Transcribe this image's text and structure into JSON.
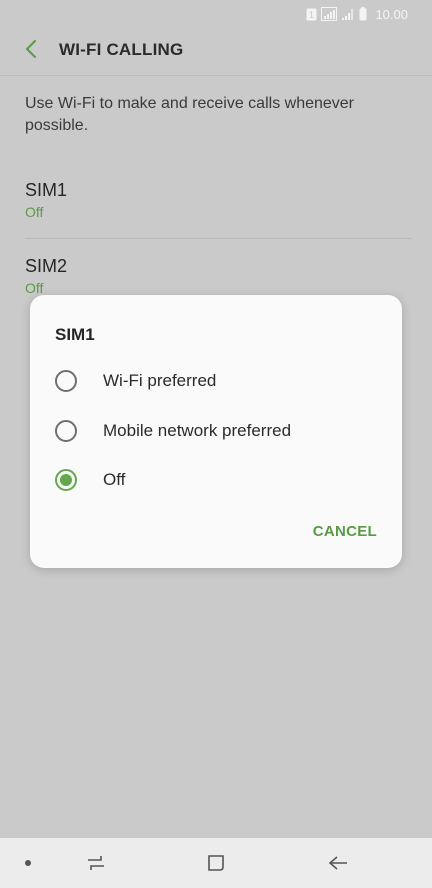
{
  "status_bar": {
    "sim_badge": "1",
    "time": "10.00",
    "icons": [
      "sim-1-icon",
      "signal-icon",
      "signal-weak-icon",
      "battery-icon"
    ]
  },
  "header": {
    "title": "WI-FI CALLING",
    "back_icon": "chevron-left-icon"
  },
  "description": "Use Wi-Fi to make and receive calls whenever possible.",
  "settings": [
    {
      "title": "SIM1",
      "value": "Off"
    },
    {
      "title": "SIM2",
      "value": "Off"
    }
  ],
  "dialog": {
    "title": "SIM1",
    "options": [
      {
        "label": "Wi-Fi preferred",
        "selected": false
      },
      {
        "label": "Mobile network preferred",
        "selected": false
      },
      {
        "label": "Off",
        "selected": true
      }
    ],
    "cancel_label": "CANCEL"
  },
  "nav_bar": {
    "icons": [
      "dot-icon",
      "recent-apps-icon",
      "home-icon",
      "back-arrow-icon"
    ]
  },
  "colors": {
    "accent": "#62a94b",
    "accent_text": "#5a9a47",
    "background": "#cacaca",
    "dialog_bg": "#fafafa",
    "nav_bar_bg": "#ececec"
  }
}
